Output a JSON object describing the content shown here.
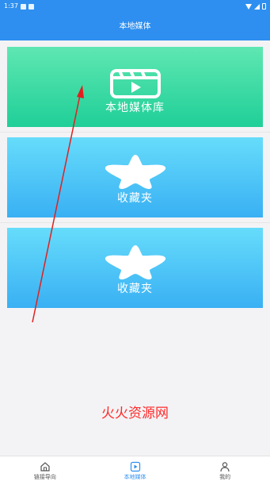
{
  "status_bar": {
    "time": "1:37"
  },
  "app_bar": {
    "title": "本地媒体"
  },
  "cards": [
    {
      "label": "本地媒体库",
      "icon": "film-clapper-icon"
    },
    {
      "label": "收藏夹",
      "icon": "star-icon"
    },
    {
      "label": "收藏夹",
      "icon": "star-icon"
    }
  ],
  "watermark": "火火资源网",
  "tabs": [
    {
      "label": "链接导向",
      "icon": "home-icon",
      "active": false
    },
    {
      "label": "本地媒体",
      "icon": "play-icon",
      "active": true
    },
    {
      "label": "我的",
      "icon": "person-icon",
      "active": false
    }
  ],
  "colors": {
    "primary": "#2e8ff0",
    "card_green": "#20cf98",
    "card_blue": "#39b0f3",
    "annotation_red": "#ff2a2a"
  }
}
